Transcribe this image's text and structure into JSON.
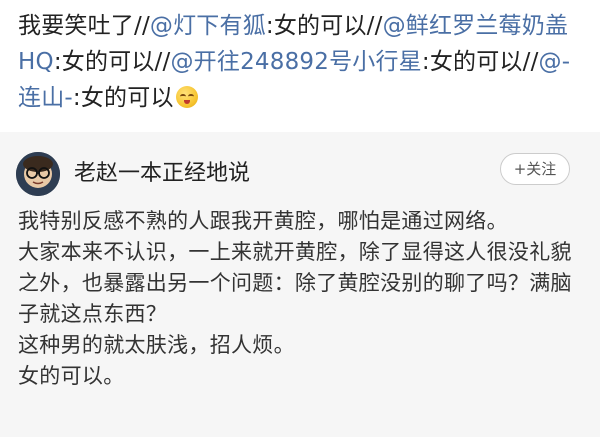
{
  "repost_chain": [
    {
      "type": "text",
      "value": "我要笑吐了//"
    },
    {
      "type": "mention",
      "value": "@灯下有狐"
    },
    {
      "type": "text",
      "value": ":女的可以//"
    },
    {
      "type": "mention",
      "value": "@鲜红罗兰莓奶盖HQ"
    },
    {
      "type": "text",
      "value": ":女的可以//"
    },
    {
      "type": "mention",
      "value": "@开往248892号小行星"
    },
    {
      "type": "text",
      "value": ":女的可以//"
    },
    {
      "type": "mention",
      "value": "@-连山-"
    },
    {
      "type": "text",
      "value": ":女的可以"
    }
  ],
  "repost_emoji": "laughing-face-icon",
  "original_post": {
    "username": "老赵一本正经地说",
    "follow_label": "+关注",
    "lines": [
      "我特别反感不熟的人跟我开黄腔，哪怕是通过网络。",
      "大家本来不认识，一上来就开黄腔，除了显得这人很没礼貌之外，也暴露出另一个问题：除了黄腔没别的聊了吗？满脑子就这点东西？",
      "这种男的就太肤浅，招人烦。",
      "女的可以。"
    ]
  },
  "colors": {
    "mention": "#4a6fa5",
    "card_bg": "#f6f6f6",
    "text": "#222222"
  }
}
